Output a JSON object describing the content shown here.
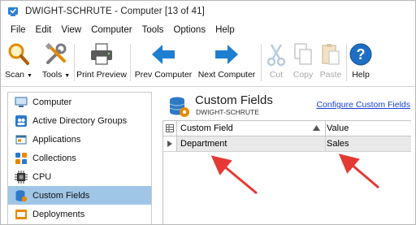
{
  "window": {
    "title": "DWIGHT-SCHRUTE - Computer [13 of 41]"
  },
  "menu": [
    "File",
    "Edit",
    "View",
    "Computer",
    "Tools",
    "Options",
    "Help"
  ],
  "toolbar": {
    "scan_label": "Scan",
    "tools_label": "Tools",
    "print_preview_label": "Print Preview",
    "prev_computer_label": "Prev Computer",
    "next_computer_label": "Next Computer",
    "cut_label": "Cut",
    "copy_label": "Copy",
    "paste_label": "Paste",
    "help_label": "Help"
  },
  "sidebar": {
    "items": [
      {
        "label": "Computer",
        "icon": "computer-icon"
      },
      {
        "label": "Active Directory Groups",
        "icon": "ad-groups-icon"
      },
      {
        "label": "Applications",
        "icon": "applications-icon"
      },
      {
        "label": "Collections",
        "icon": "collections-icon"
      },
      {
        "label": "CPU",
        "icon": "cpu-icon"
      },
      {
        "label": "Custom Fields",
        "icon": "database-icon",
        "selected": true
      },
      {
        "label": "Deployments",
        "icon": "deployments-icon"
      }
    ]
  },
  "main": {
    "title": "Custom Fields",
    "subtitle": "DWIGHT-SCHRUTE",
    "configure_link": "Configure Custom Fields",
    "grid": {
      "columns": [
        "Custom Field",
        "Value"
      ],
      "rows": [
        {
          "field": "Department",
          "value": "Sales"
        }
      ]
    }
  },
  "colors": {
    "selection": "#9fc6e7",
    "link": "#1a3fd6",
    "annotation_arrow": "#e53935",
    "arrow_blue": "#1e7fd0"
  }
}
